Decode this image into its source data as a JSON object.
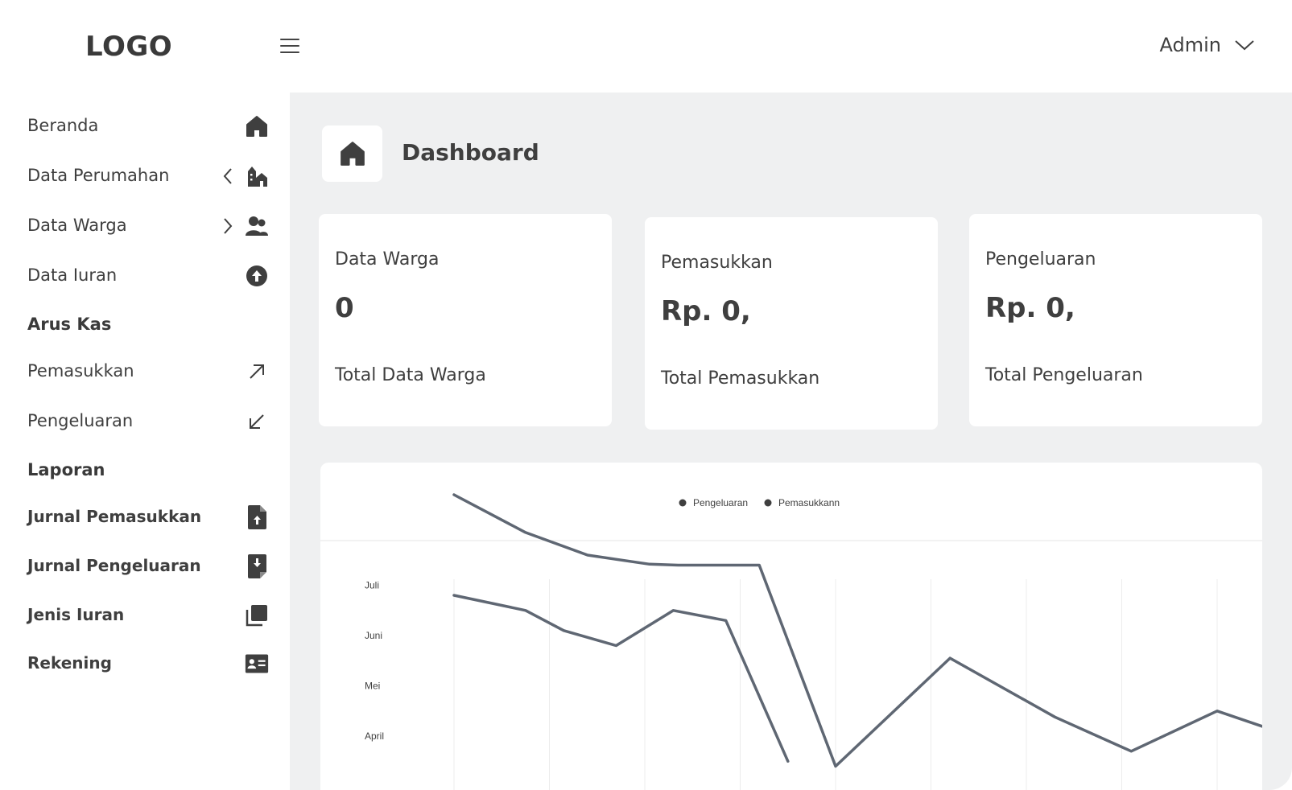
{
  "header": {
    "logo": "LOGO",
    "user": "Admin"
  },
  "sidebar": {
    "items": [
      {
        "label": "Beranda",
        "icon": "home-icon"
      },
      {
        "label": "Data Perumahan",
        "icon": "buildings-icon",
        "chevron": "chevron-left-icon"
      },
      {
        "label": "Data Warga",
        "icon": "users-icon",
        "chevron": "chevron-right-icon"
      },
      {
        "label": "Data Iuran",
        "icon": "arrow-up-circle-icon"
      }
    ],
    "arus_kas_title": "Arus Kas",
    "arus_kas": [
      {
        "label": "Pemasukkan",
        "icon": "arrow-up-right-icon"
      },
      {
        "label": "Pengeluaran",
        "icon": "arrow-down-left-icon"
      }
    ],
    "laporan_title": "Laporan",
    "laporan": [
      {
        "label": "Jurnal Pemasukkan",
        "icon": "file-upload-icon"
      },
      {
        "label": "Jurnal Pengeluaran",
        "icon": "file-download-icon"
      },
      {
        "label": "Jenis Iuran",
        "icon": "copy-icon"
      },
      {
        "label": "Rekening",
        "icon": "id-card-icon"
      }
    ]
  },
  "main": {
    "title": "Dashboard",
    "cards": [
      {
        "title": "Data Warga",
        "value": "0",
        "subtitle": "Total Data Warga"
      },
      {
        "title": "Pemasukkan",
        "value": "Rp. 0,",
        "subtitle": "Total Pemasukkan"
      },
      {
        "title": "Pengeluaran",
        "value": "Rp. 0,",
        "subtitle": "Total Pengeluaran"
      }
    ]
  },
  "colors": {
    "main_bg": "#eff0f1",
    "line": "#5f6773",
    "text": "#3f3f3f"
  },
  "chart_data": {
    "type": "line",
    "legend": [
      "Pengeluaran",
      "Pemasukkann"
    ],
    "legend_position": "top-center",
    "y_categories": [
      "April",
      "Mei",
      "Juni",
      "Juli"
    ],
    "grid": "vertical",
    "series": [
      {
        "name": "Pengeluaran",
        "points": [
          [
            0,
            4.8
          ],
          [
            0.75,
            4.05
          ],
          [
            1.4,
            3.6
          ],
          [
            2.05,
            3.42
          ],
          [
            2.35,
            3.4
          ],
          [
            3.2,
            3.4
          ],
          [
            4.0,
            -0.6
          ],
          [
            5.2,
            1.55
          ],
          [
            6.3,
            0.38
          ],
          [
            7.1,
            -0.3
          ],
          [
            8.0,
            0.5
          ],
          [
            8.85,
            -0.05
          ],
          [
            9.3,
            -0.5
          ]
        ]
      },
      {
        "name": "Pemasukkann",
        "points": [
          [
            0,
            2.8
          ],
          [
            0.75,
            2.5
          ],
          [
            1.15,
            2.1
          ],
          [
            1.7,
            1.8
          ],
          [
            2.3,
            2.5
          ],
          [
            2.85,
            2.3
          ],
          [
            3.5,
            -0.5
          ]
        ]
      }
    ]
  }
}
